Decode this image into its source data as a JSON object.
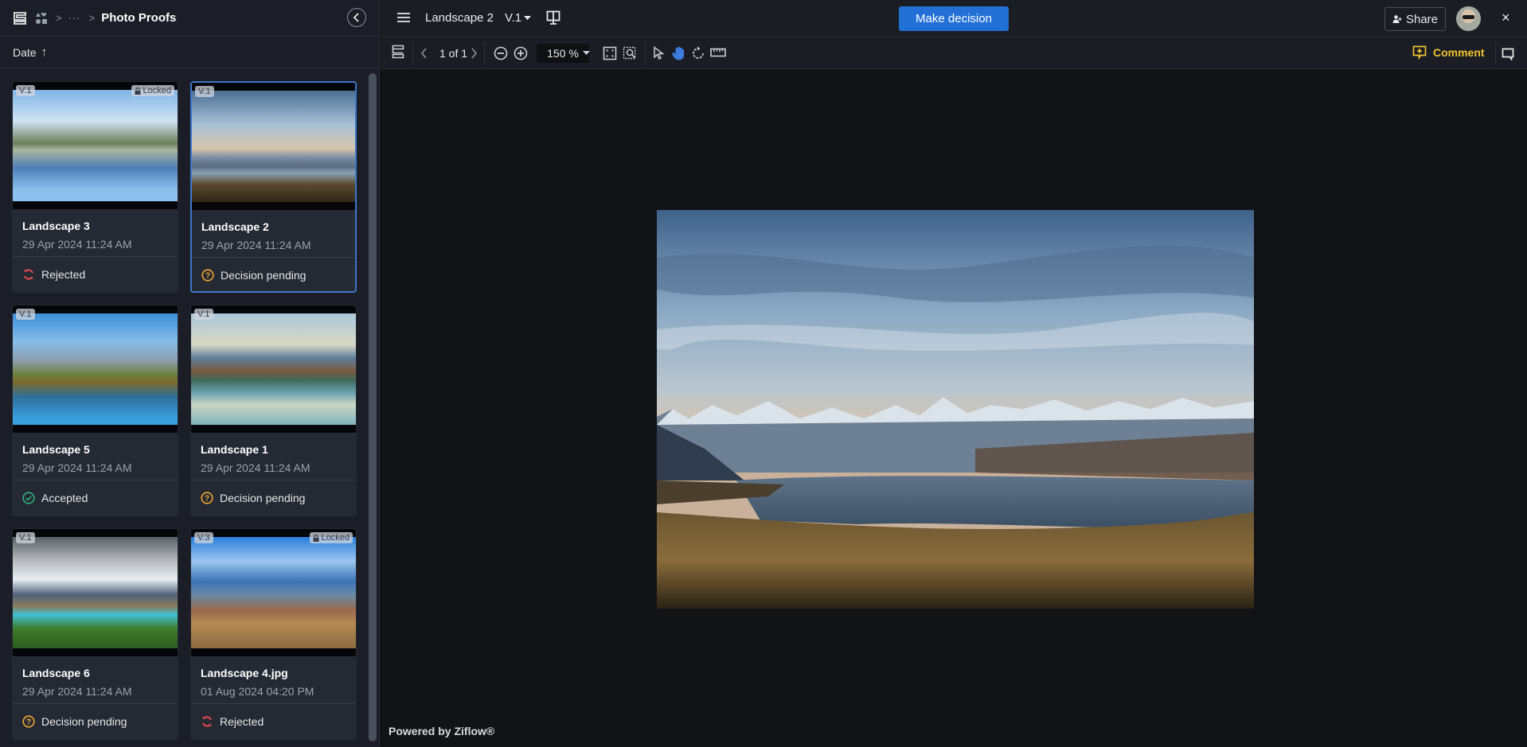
{
  "breadcrumb": {
    "ellipsis": "···",
    "current": "Photo Proofs"
  },
  "sort": {
    "label": "Date",
    "direction_icon": "↑"
  },
  "cards": [
    {
      "name": "Landscape 3",
      "date": "29 Apr 2024 11:24 AM",
      "version": "V.1",
      "locked": true,
      "lock_label": "Locked",
      "status": "Rejected",
      "status_type": "rejected",
      "selected": false
    },
    {
      "name": "Landscape 2",
      "date": "29 Apr 2024 11:24 AM",
      "version": "V.1",
      "locked": false,
      "lock_label": "",
      "status": "Decision pending",
      "status_type": "pending",
      "selected": true
    },
    {
      "name": "Landscape 5",
      "date": "29 Apr 2024 11:24 AM",
      "version": "V.1",
      "locked": false,
      "lock_label": "",
      "status": "Accepted",
      "status_type": "accepted",
      "selected": false
    },
    {
      "name": "Landscape 1",
      "date": "29 Apr 2024 11:24 AM",
      "version": "V.1",
      "locked": false,
      "lock_label": "",
      "status": "Decision pending",
      "status_type": "pending",
      "selected": false
    },
    {
      "name": "Landscape 6",
      "date": "29 Apr 2024 11:24 AM",
      "version": "V.1",
      "locked": false,
      "lock_label": "",
      "status": "Decision pending",
      "status_type": "pending",
      "selected": false
    },
    {
      "name": "Landscape 4.jpg",
      "date": "01 Aug 2024 04:20 PM",
      "version": "V.3",
      "locked": true,
      "lock_label": "Locked",
      "status": "Rejected",
      "status_type": "rejected",
      "selected": false
    }
  ],
  "header": {
    "file_title": "Landscape 2",
    "version": "V.1",
    "decision_button": "Make decision",
    "share_button": "Share",
    "close": "×"
  },
  "toolbar": {
    "page_indicator": "1 of 1",
    "zoom_value": "150 %",
    "comment_button": "Comment"
  },
  "footer": {
    "powered_by": "Powered by Ziflow®"
  },
  "colors": {
    "accent": "#2270d6",
    "selected_border": "#3b78c8",
    "rejected": "#e5484d",
    "pending": "#f0a630",
    "accepted": "#2fb37c",
    "comment": "#f2c230",
    "active_tool": "#3d7be0"
  }
}
